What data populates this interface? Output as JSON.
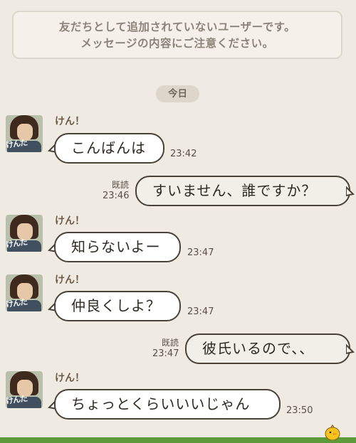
{
  "notice": {
    "line1": "友だちとして追加されていないユーザーです。",
    "line2": "メッセージの内容にご注意ください。"
  },
  "date_separator": "今日",
  "contact": {
    "name": "けん！",
    "avatar_text": "けんた"
  },
  "messages": [
    {
      "side": "in",
      "text": "こんばんは",
      "time": "23:42"
    },
    {
      "side": "out",
      "text": "すいません、誰ですか？",
      "time": "23:46",
      "read": "既読"
    },
    {
      "side": "in",
      "text": "知らないよー",
      "time": "23:47"
    },
    {
      "side": "in",
      "text": "仲良くしよ？",
      "time": "23:47"
    },
    {
      "side": "out",
      "text": "彼氏いるので、、",
      "time": "23:47",
      "read": "既読"
    },
    {
      "side": "in",
      "text": "ちょっとくらいいいじゃん",
      "time": "23:50"
    }
  ]
}
